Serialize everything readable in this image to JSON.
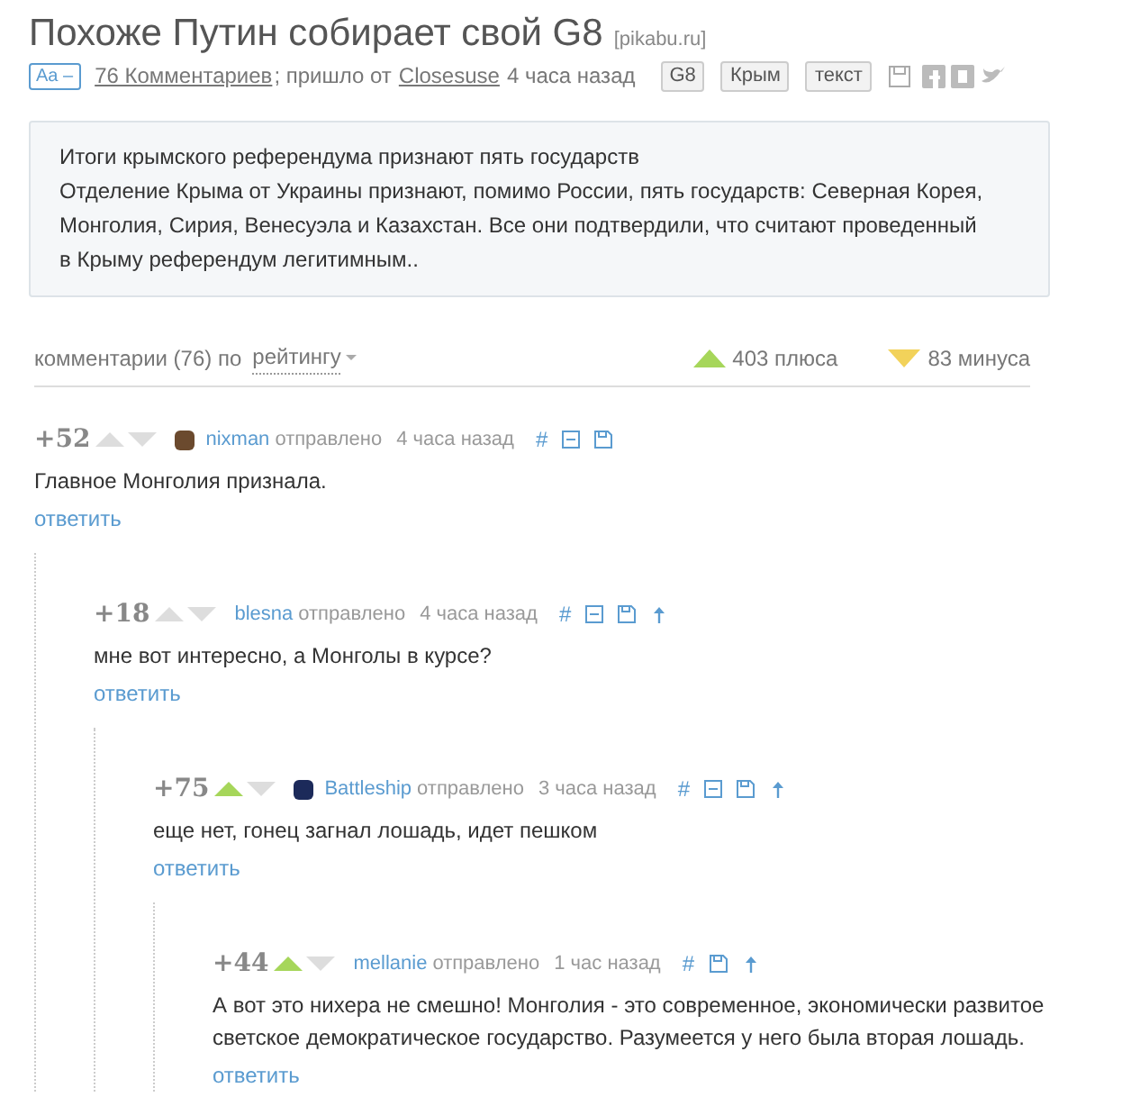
{
  "post": {
    "title": "Похоже Путин собирает свой G8",
    "source": "[pikabu.ru]",
    "font_toggle": "Aa –",
    "comments_link": "76 Комментариев",
    "via_text": "; пришло от",
    "author": "Closesuse",
    "time": "4 часа назад",
    "tags": [
      "G8",
      "Крым",
      "текст"
    ]
  },
  "description": {
    "heading": "Итоги крымского референдума признают пять государств",
    "body": "Отделение Крыма от Украины признают, помимо России, пять государств: Северная Корея, Монголия, Сирия, Венесуэла и Казахстан. Все они подтвердили, что считают проведенный в Крыму референдум легитимным.."
  },
  "comments_header": {
    "label": "комментарии (76) по",
    "sort": "рейтингу",
    "pluses": "403 плюса",
    "minuses": "83 минуса"
  },
  "comments": [
    {
      "score": "+52",
      "upvoted": false,
      "avatar": {
        "color": "#6b4a2e"
      },
      "author": "nixman",
      "sent": "отправлено",
      "time": "4 часа назад",
      "anchor": "#",
      "collapsible": true,
      "has_parent": false,
      "text": "Главное Монголия признала.",
      "reply": "ответить",
      "children": [
        {
          "score": "+18",
          "upvoted": false,
          "author": "blesna",
          "sent": "отправлено",
          "time": "4 часа назад",
          "anchor": "#",
          "collapsible": true,
          "has_parent": true,
          "text": "мне вот интересно, а Монголы в курсе?",
          "reply": "ответить",
          "children": [
            {
              "score": "+75",
              "upvoted": true,
              "avatar": {
                "color": "#1c2a5a"
              },
              "author": "Battleship",
              "sent": "отправлено",
              "time": "3 часа назад",
              "anchor": "#",
              "collapsible": true,
              "has_parent": true,
              "text": "еще нет, гонец загнал лошадь, идет пешком",
              "reply": "ответить",
              "children": [
                {
                  "score": "+44",
                  "upvoted": true,
                  "author": "mellanie",
                  "sent": "отправлено",
                  "time": "1 час назад",
                  "anchor": "#",
                  "collapsible": false,
                  "has_parent": true,
                  "text": "А вот это нихера не смешно! Монголия - это современное, экономически развитое светское демократическое государство. Разумеется у него была вторая лошадь.",
                  "reply": "ответить"
                }
              ]
            }
          ]
        }
      ]
    }
  ]
}
